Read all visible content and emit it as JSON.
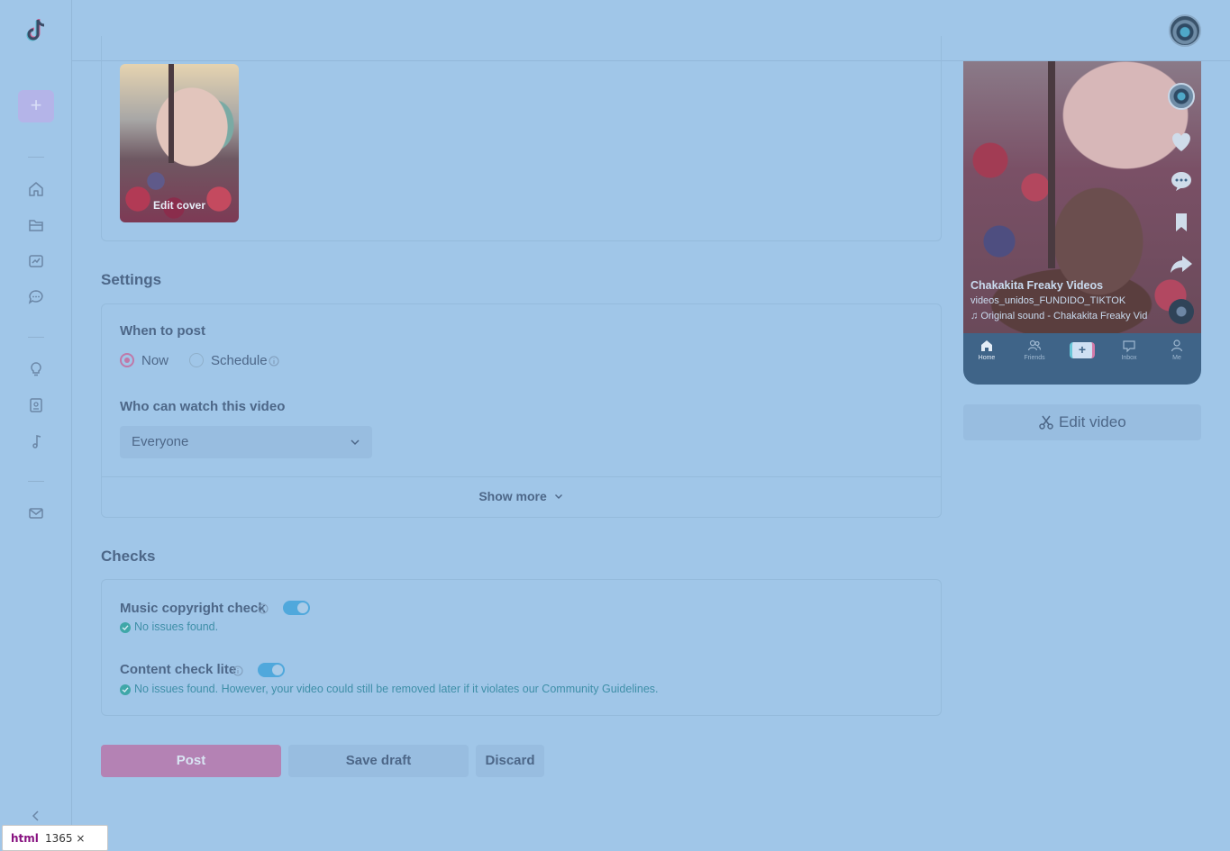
{
  "cover": {
    "edit_label": "Edit cover"
  },
  "settings": {
    "title": "Settings",
    "when_to_post": {
      "label": "When to post",
      "options": [
        "Now",
        "Schedule"
      ],
      "selected": "Now"
    },
    "who_can_watch": {
      "label": "Who can watch this video",
      "value": "Everyone"
    },
    "show_more": "Show more"
  },
  "checks": {
    "title": "Checks",
    "music": {
      "label": "Music copyright check",
      "enabled": true,
      "result": "No issues found."
    },
    "content": {
      "label": "Content check lite",
      "enabled": true,
      "result": "No issues found. However, your video could still be removed later if it violates our Community Guidelines."
    }
  },
  "actions": {
    "post": "Post",
    "save_draft": "Save draft",
    "discard": "Discard"
  },
  "preview": {
    "username": "Chakakita Freaky Videos",
    "caption": "videos_unidos_FUNDIDO_TIKTOK",
    "sound": "Original sound - Chakakita Freaky Vid",
    "nav": [
      "Home",
      "Friends",
      "Inbox",
      "Me"
    ],
    "edit_video": "Edit video"
  },
  "devtools": {
    "tag": "html",
    "size": "1365 × 945"
  },
  "colors": {
    "accent": "#c078a8",
    "toggle": "#50a8dc",
    "background": "#a0c6e8"
  }
}
